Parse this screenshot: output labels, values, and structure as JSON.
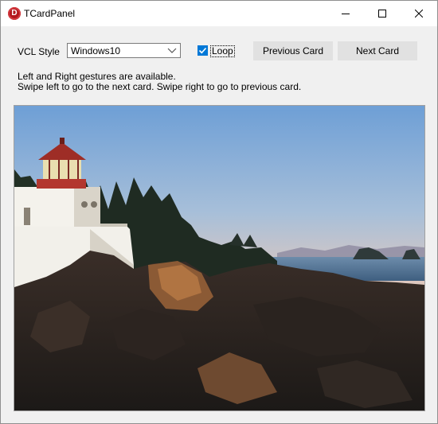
{
  "window": {
    "title": "TCardPanel",
    "app_icon_letter": "D"
  },
  "controls": {
    "vcl_style_label": "VCL Style",
    "vcl_style_value": "Windows10",
    "loop_label": "Loop",
    "loop_checked": true,
    "prev_button": "Previous Card",
    "next_button": "Next Card"
  },
  "info": {
    "line1": "Left and Right gestures are available.",
    "line2": "Swipe left to go to the next card. Swipe right to go to previous card."
  },
  "card": {
    "image_subject": "lighthouse-on-rocky-coast-at-sunset"
  }
}
